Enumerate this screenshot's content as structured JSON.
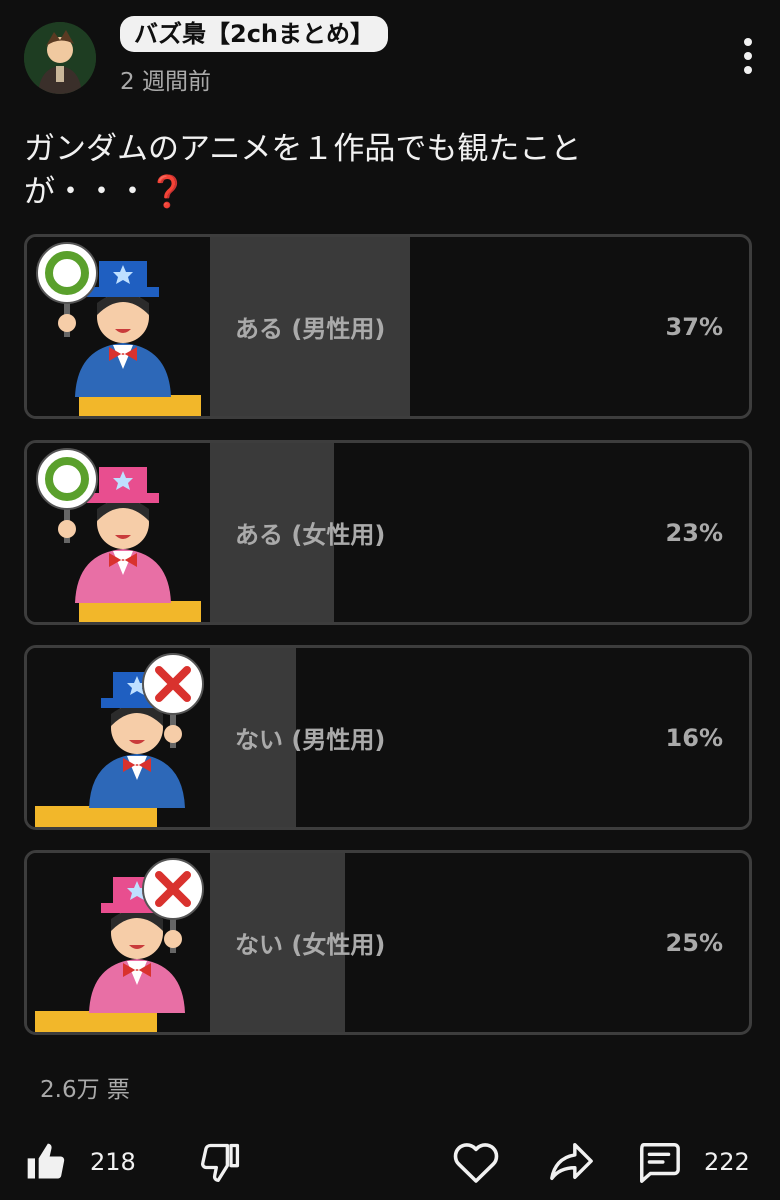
{
  "post": {
    "channel_name": "バズ梟【2chまとめ】",
    "time_ago": "2 週間前",
    "question": "ガンダムのアニメを１作品でも観たことが・・・",
    "question_emoji": "❓"
  },
  "poll": {
    "options": [
      {
        "label": "ある (男性用)",
        "percent_text": "37%",
        "percent": 37,
        "hat_color": "#1f5fc1",
        "coat_color": "#2d68b8",
        "sign": "circle"
      },
      {
        "label": "ある (女性用)",
        "percent_text": "23%",
        "percent": 23,
        "hat_color": "#e84e8f",
        "coat_color": "#e86fa5",
        "sign": "circle"
      },
      {
        "label": "ない (男性用)",
        "percent_text": "16%",
        "percent": 16,
        "hat_color": "#1f5fc1",
        "coat_color": "#2d68b8",
        "sign": "cross"
      },
      {
        "label": "ない (女性用)",
        "percent_text": "25%",
        "percent": 25,
        "hat_color": "#e84e8f",
        "coat_color": "#e86fa5",
        "sign": "cross"
      }
    ],
    "votes_text": "2.6万 票"
  },
  "actions": {
    "likes": "218",
    "comments": "222"
  },
  "icons": {
    "like": "thumbs-up-icon",
    "dislike": "thumbs-down-icon",
    "heart": "heart-icon",
    "share": "share-icon",
    "comment": "comment-icon",
    "menu": "more-vertical-icon"
  },
  "colors": {
    "background": "#0f0f0f",
    "bar_fill": "#3a3a3a",
    "border": "#3d3d3d",
    "text_muted": "#aaaaaa"
  }
}
